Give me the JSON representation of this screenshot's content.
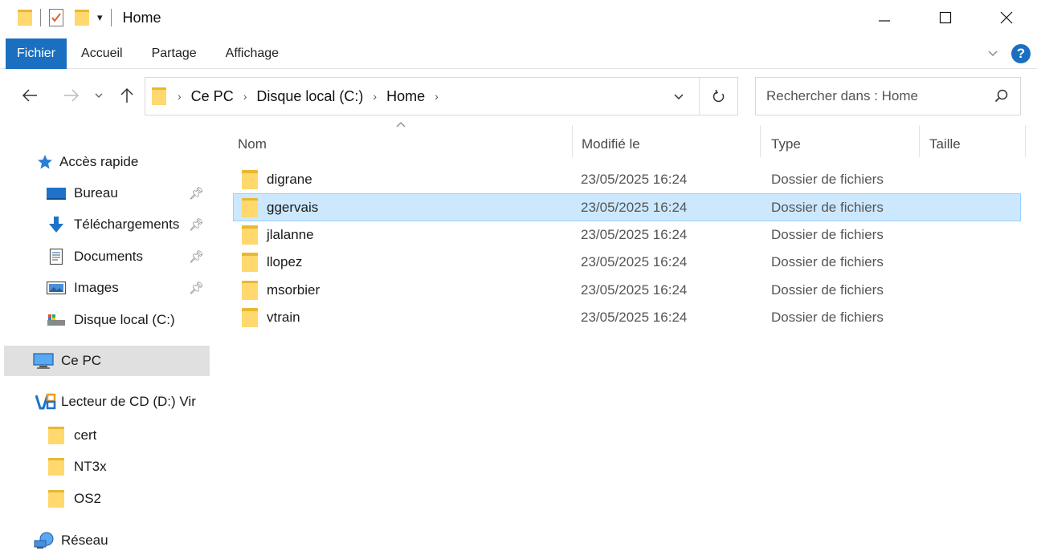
{
  "window": {
    "title": "Home",
    "qat_dropdown_glyph": "▾"
  },
  "ribbon": {
    "tabs": [
      "Fichier",
      "Accueil",
      "Partage",
      "Affichage"
    ],
    "active_tab": "Fichier",
    "help_glyph": "?"
  },
  "address": {
    "breadcrumb": [
      "Ce PC",
      "Disque local (C:)",
      "Home"
    ],
    "search_placeholder": "Rechercher dans : Home"
  },
  "sidebar": {
    "quick_access_label": "Accès rapide",
    "items": [
      {
        "label": "Bureau",
        "icon": "desktop-icon",
        "pinned": true
      },
      {
        "label": "Téléchargements",
        "icon": "download-icon",
        "pinned": true
      },
      {
        "label": "Documents",
        "icon": "documents-icon",
        "pinned": true
      },
      {
        "label": "Images",
        "icon": "images-icon",
        "pinned": true
      },
      {
        "label": "Disque local (C:)",
        "icon": "drive-icon",
        "pinned": false
      }
    ],
    "this_pc_label": "Ce PC",
    "cd_drive_label": "Lecteur de CD (D:) Vir",
    "cd_folders": [
      "cert",
      "NT3x",
      "OS2"
    ],
    "network_label": "Réseau"
  },
  "columns": {
    "name": "Nom",
    "modified": "Modifié le",
    "type": "Type",
    "size": "Taille"
  },
  "files": [
    {
      "name": "digrane",
      "modified": "23/05/2025 16:24",
      "type": "Dossier de fichiers",
      "selected": false
    },
    {
      "name": "ggervais",
      "modified": "23/05/2025 16:24",
      "type": "Dossier de fichiers",
      "selected": true
    },
    {
      "name": "jlalanne",
      "modified": "23/05/2025 16:24",
      "type": "Dossier de fichiers",
      "selected": false
    },
    {
      "name": "llopez",
      "modified": "23/05/2025 16:24",
      "type": "Dossier de fichiers",
      "selected": false
    },
    {
      "name": "msorbier",
      "modified": "23/05/2025 16:24",
      "type": "Dossier de fichiers",
      "selected": false
    },
    {
      "name": "vtrain",
      "modified": "23/05/2025 16:24",
      "type": "Dossier de fichiers",
      "selected": false
    }
  ],
  "colors": {
    "accent": "#1a6fc0",
    "selection_bg": "#cce8ff",
    "selection_border": "#99d1ff",
    "folder_front": "#ffd86e",
    "folder_back": "#e8b830"
  }
}
